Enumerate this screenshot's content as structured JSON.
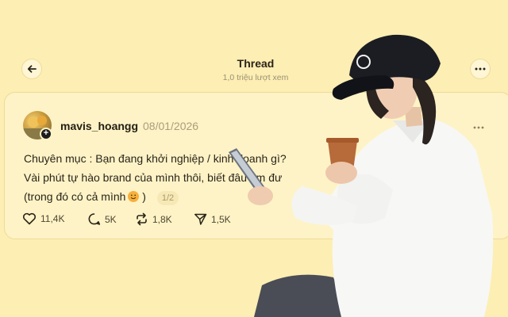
{
  "header": {
    "title": "Thread",
    "views": "1,0 triệu lượt xem"
  },
  "post": {
    "username": "mavis_hoangg",
    "date": "08/01/2026",
    "lines": [
      "Chuyên mục : Bạn đang khởi nghiệp / kinh doanh gì?",
      "Vài phút tự hào brand của mình thôi, biết đâu tìm đư",
      "(trong đó có cả mình"
    ],
    "line3_suffix": ")",
    "page_indicator": "1/2",
    "stats": {
      "likes": "11,4K",
      "replies": "5K",
      "reposts": "1,8K",
      "shares": "1,5K"
    }
  },
  "colors": {
    "background": "#fdeeb3",
    "card": "#fef3c6"
  },
  "icons": [
    "back-arrow-icon",
    "more-icon",
    "heart-icon",
    "comment-icon",
    "repost-icon",
    "share-icon",
    "smile-emoji-icon"
  ]
}
